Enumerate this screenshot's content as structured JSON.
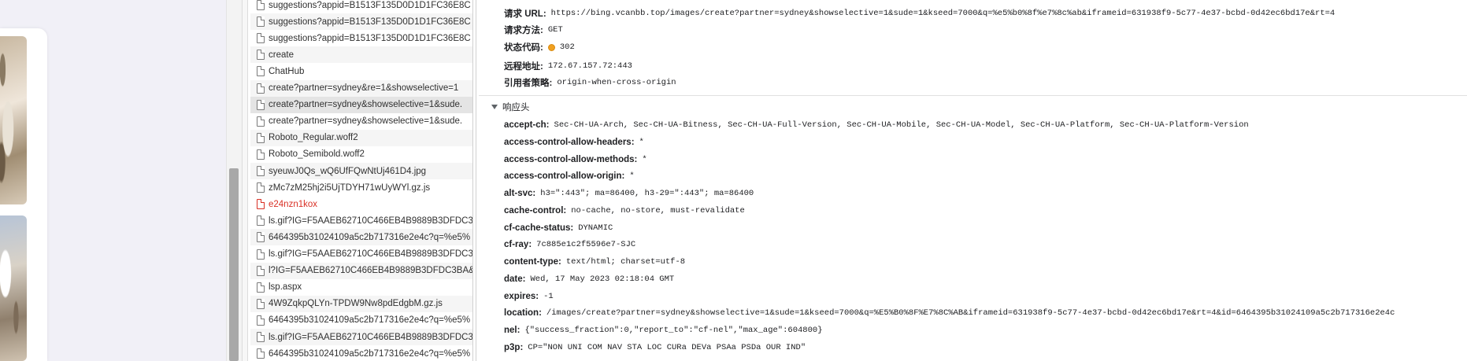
{
  "request_list": [
    {
      "label": "suggestions?appid=B1513F135D0D1D1FC36E8C",
      "style": "normal"
    },
    {
      "label": "suggestions?appid=B1513F135D0D1D1FC36E8C",
      "style": "alt"
    },
    {
      "label": "suggestions?appid=B1513F135D0D1D1FC36E8C",
      "style": "normal"
    },
    {
      "label": "create",
      "style": "alt"
    },
    {
      "label": "ChatHub",
      "style": "normal"
    },
    {
      "label": "create?partner=sydney&re=1&showselective=1",
      "style": "alt"
    },
    {
      "label": "create?partner=sydney&showselective=1&sude.",
      "style": "selected"
    },
    {
      "label": "create?partner=sydney&showselective=1&sude.",
      "style": "normal"
    },
    {
      "label": "Roboto_Regular.woff2",
      "style": "alt"
    },
    {
      "label": "Roboto_Semibold.woff2",
      "style": "normal"
    },
    {
      "label": "syeuwJ0Qs_wQ6UfFQwNtUj461D4.jpg",
      "style": "alt"
    },
    {
      "label": "zMc7zM25hj2i5UjTDYH71wUyWYl.gz.js",
      "style": "normal"
    },
    {
      "label": "e24nzn1kox",
      "style": "error"
    },
    {
      "label": "ls.gif?IG=F5AAEB62710C466EB4B9889B3DFDC3B",
      "style": "normal"
    },
    {
      "label": "6464395b31024109a5c2b717316e2e4c?q=%e5%",
      "style": "alt"
    },
    {
      "label": "ls.gif?IG=F5AAEB62710C466EB4B9889B3DFDC3B",
      "style": "normal"
    },
    {
      "label": "l?IG=F5AAEB62710C466EB4B9889B3DFDC3BA&.",
      "style": "alt"
    },
    {
      "label": "lsp.aspx",
      "style": "normal"
    },
    {
      "label": "4W9ZqkpQLYn-TPDW9Nw8pdEdgbM.gz.js",
      "style": "alt"
    },
    {
      "label": "6464395b31024109a5c2b717316e2e4c?q=%e5%",
      "style": "normal"
    },
    {
      "label": "ls.gif?IG=F5AAEB62710C466EB4B9889B3DFDC3B",
      "style": "alt"
    },
    {
      "label": "6464395b31024109a5c2b717316e2e4c?q=%e5%",
      "style": "normal"
    }
  ],
  "general": [
    {
      "key": "请求 URL:",
      "value": "https://bing.vcanbb.top/images/create?partner=sydney&showselective=1&sude=1&kseed=7000&q=%e5%b0%8f%e7%8c%ab&iframeid=631938f9-5c77-4e37-bcbd-0d42ec6bd17e&rt=4"
    },
    {
      "key": "请求方法:",
      "value": "GET"
    },
    {
      "key": "状态代码:",
      "value": "302"
    },
    {
      "key": "远程地址:",
      "value": "172.67.157.72:443"
    },
    {
      "key": "引用者策略:",
      "value": "origin-when-cross-origin"
    }
  ],
  "status_color": "#f0a020",
  "response_section_label": "响应头",
  "response_headers": [
    {
      "key": "accept-ch:",
      "value": "Sec-CH-UA-Arch, Sec-CH-UA-Bitness, Sec-CH-UA-Full-Version, Sec-CH-UA-Mobile, Sec-CH-UA-Model, Sec-CH-UA-Platform, Sec-CH-UA-Platform-Version"
    },
    {
      "key": "access-control-allow-headers:",
      "value": "*"
    },
    {
      "key": "access-control-allow-methods:",
      "value": "*"
    },
    {
      "key": "access-control-allow-origin:",
      "value": "*"
    },
    {
      "key": "alt-svc:",
      "value": "h3=\":443\"; ma=86400, h3-29=\":443\"; ma=86400"
    },
    {
      "key": "cache-control:",
      "value": "no-cache, no-store, must-revalidate"
    },
    {
      "key": "cf-cache-status:",
      "value": "DYNAMIC"
    },
    {
      "key": "cf-ray:",
      "value": "7c885e1c2f5596e7-SJC"
    },
    {
      "key": "content-type:",
      "value": "text/html; charset=utf-8"
    },
    {
      "key": "date:",
      "value": "Wed, 17 May 2023 02:18:04 GMT"
    },
    {
      "key": "expires:",
      "value": "-1"
    },
    {
      "key": "location:",
      "value": "/images/create?partner=sydney&showselective=1&sude=1&kseed=7000&q=%E5%B0%8F%E7%8C%AB&iframeid=631938f9-5c77-4e37-bcbd-0d42ec6bd17e&rt=4&id=6464395b31024109a5c2b717316e2e4c"
    },
    {
      "key": "nel:",
      "value": "{\"success_fraction\":0,\"report_to\":\"cf-nel\",\"max_age\":604800}"
    },
    {
      "key": "p3p:",
      "value": "CP=\"NON UNI COM NAV STA LOC CURa DEVa PSAa PSDa OUR IND\""
    }
  ]
}
